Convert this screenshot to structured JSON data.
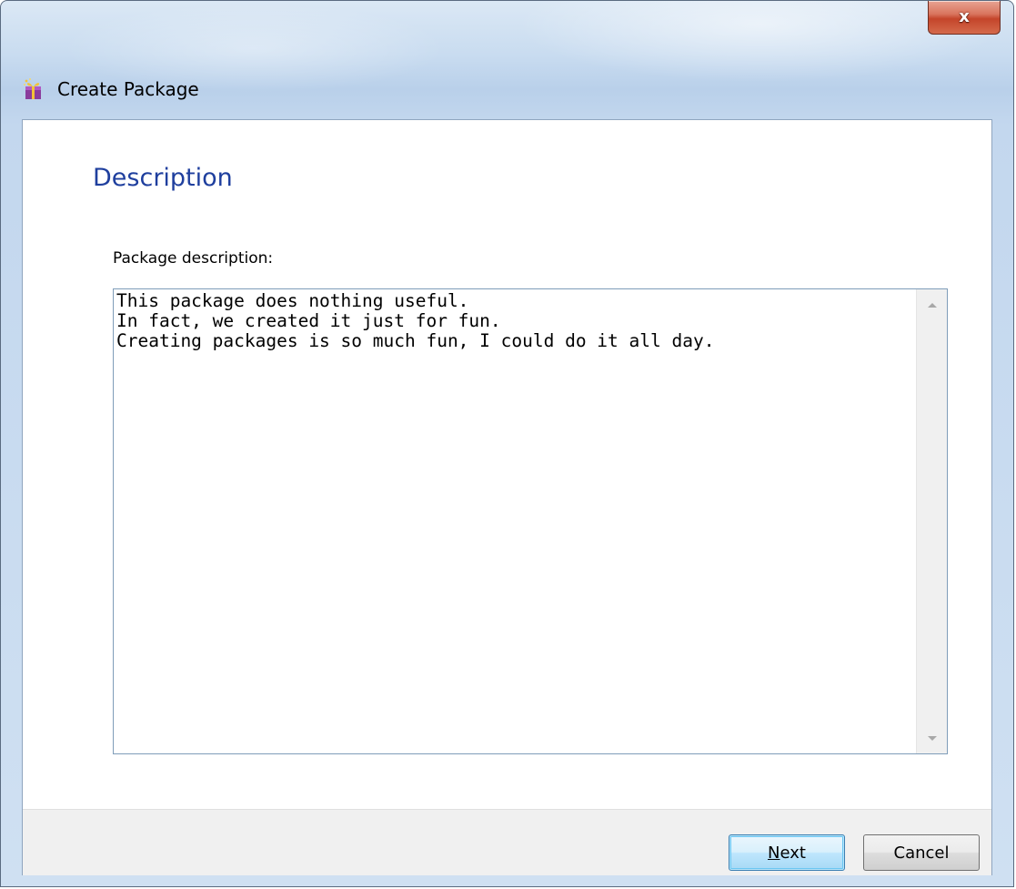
{
  "window": {
    "title": "Create Package",
    "close_label": "x"
  },
  "page": {
    "heading": "Description"
  },
  "form": {
    "description_label": "Package description:",
    "description_value": "This package does nothing useful.\nIn fact, we created it just for fun.\nCreating packages is so much fun, I could do it all day."
  },
  "buttons": {
    "next_mnemonic": "N",
    "next_rest": "ext",
    "cancel_label": "Cancel"
  },
  "colors": {
    "heading": "#1f3f9e",
    "close_button": "#c4452a",
    "default_button_border": "#3c7fb1"
  },
  "icons": {
    "app_icon": "package-gift-icon",
    "close_icon": "close-icon",
    "scroll_up_icon": "arrow-up-icon",
    "scroll_down_icon": "arrow-down-icon"
  }
}
